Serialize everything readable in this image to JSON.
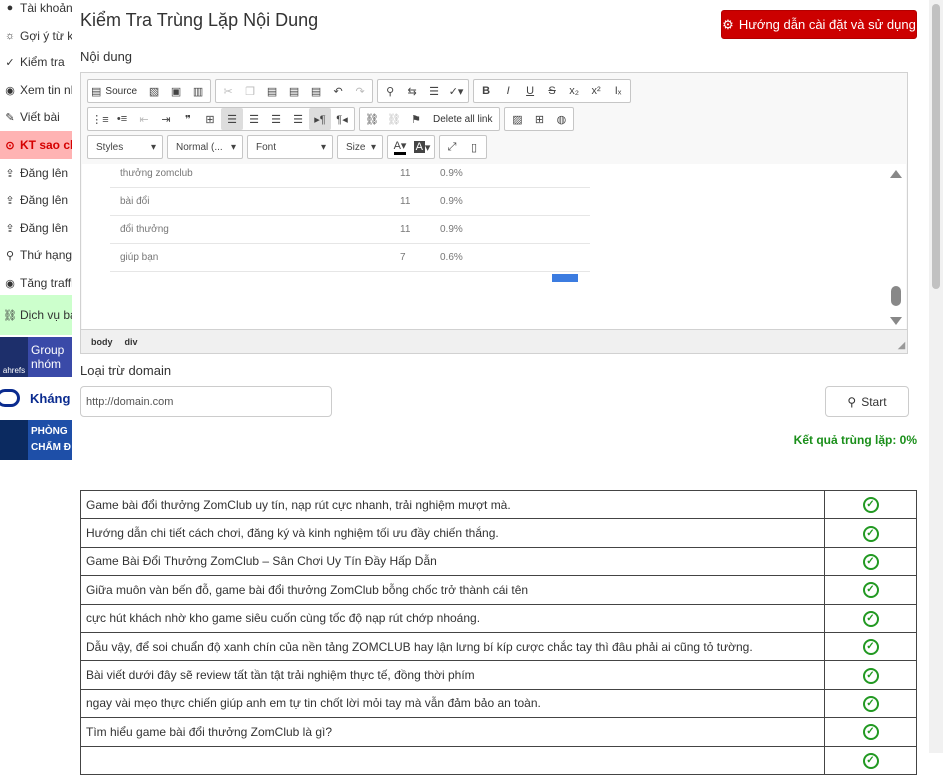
{
  "sidebar": {
    "items": [
      {
        "label": "Tài khoản",
        "icon": "user-icon"
      },
      {
        "label": "Gợi ý từ khóa",
        "icon": "bulb-icon"
      },
      {
        "label": "Kiểm tra",
        "icon": "check-icon"
      },
      {
        "label": "Xem tin nhắn",
        "icon": "eye-icon"
      },
      {
        "label": "Viết bài",
        "icon": "pencil-icon"
      },
      {
        "label": "KT sao chép",
        "icon": "copy-icon"
      },
      {
        "label": "Đăng lên",
        "icon": "upload-icon"
      },
      {
        "label": "Đăng lên",
        "icon": "upload-icon"
      },
      {
        "label": "Đăng lên",
        "icon": "upload-icon"
      },
      {
        "label": "Thứ hạng",
        "icon": "search-icon"
      },
      {
        "label": "Tăng traffic",
        "icon": "eye-icon"
      }
    ],
    "service_label": "Dịch vụ backlink",
    "banners": [
      {
        "label": "Group nhóm",
        "badge": "ahrefs"
      },
      {
        "label": "Kháng"
      },
      {
        "label": "PHÒNG",
        "sublabel": "CHẤM Đ"
      }
    ]
  },
  "page": {
    "title": "Kiểm Tra Trùng Lặp Nội Dung",
    "guide_button": "Hướng dẫn cài đặt và sử dụng",
    "content_label": "Nội dung",
    "exclude_label": "Loại trừ domain",
    "domain_placeholder": "http://domain.com",
    "start_label": "Start",
    "result_text": "Kết quả trùng lặp: 0%"
  },
  "editor": {
    "source_label": "Source",
    "delete_link_label": "Delete all link",
    "combos": [
      "Styles",
      "Normal (...",
      "Font",
      "Size"
    ],
    "keywords": [
      {
        "kw": "thưởng zomclub",
        "count": "11",
        "pct": "0.9%"
      },
      {
        "kw": "bài đổi",
        "count": "11",
        "pct": "0.9%"
      },
      {
        "kw": "đổi thưởng",
        "count": "11",
        "pct": "0.9%"
      },
      {
        "kw": "giúp bạn",
        "count": "7",
        "pct": "0.6%"
      }
    ],
    "path": [
      "body",
      "div"
    ]
  },
  "results": [
    "Game bài đổi thưởng ZomClub uy tín, nạp rút cực nhanh, trải nghiệm mượt mà.",
    "Hướng dẫn chi tiết cách chơi, đăng ký và kinh nghiệm tối ưu đầy chiến thắng.",
    "Game Bài Đổi Thưởng ZomClub – Sân Chơi Uy Tín Đầy Hấp Dẫn",
    "Giữa muôn vàn bến đỗ, game bài đổi thưởng ZomClub bỗng chốc trở thành cái tên",
    "cực hút khách nhờ kho game siêu cuốn cùng tốc độ nạp rút chớp nhoáng.",
    "Dẫu vậy, để soi chuẩn độ xanh chín của nền tảng ZOMCLUB hay lận lưng bí kíp cược chắc tay thì đâu phải ai cũng tỏ tường.",
    "Bài viết dưới đây sẽ review tất tần tật trải nghiệm thực tế, đồng thời phím",
    "ngay vài mẹo thực chiến giúp anh em tự tin chốt lời mỏi tay mà vẫn đảm bảo an toàn.",
    "Tìm hiểu game bài đổi thưởng ZomClub là gì?"
  ]
}
